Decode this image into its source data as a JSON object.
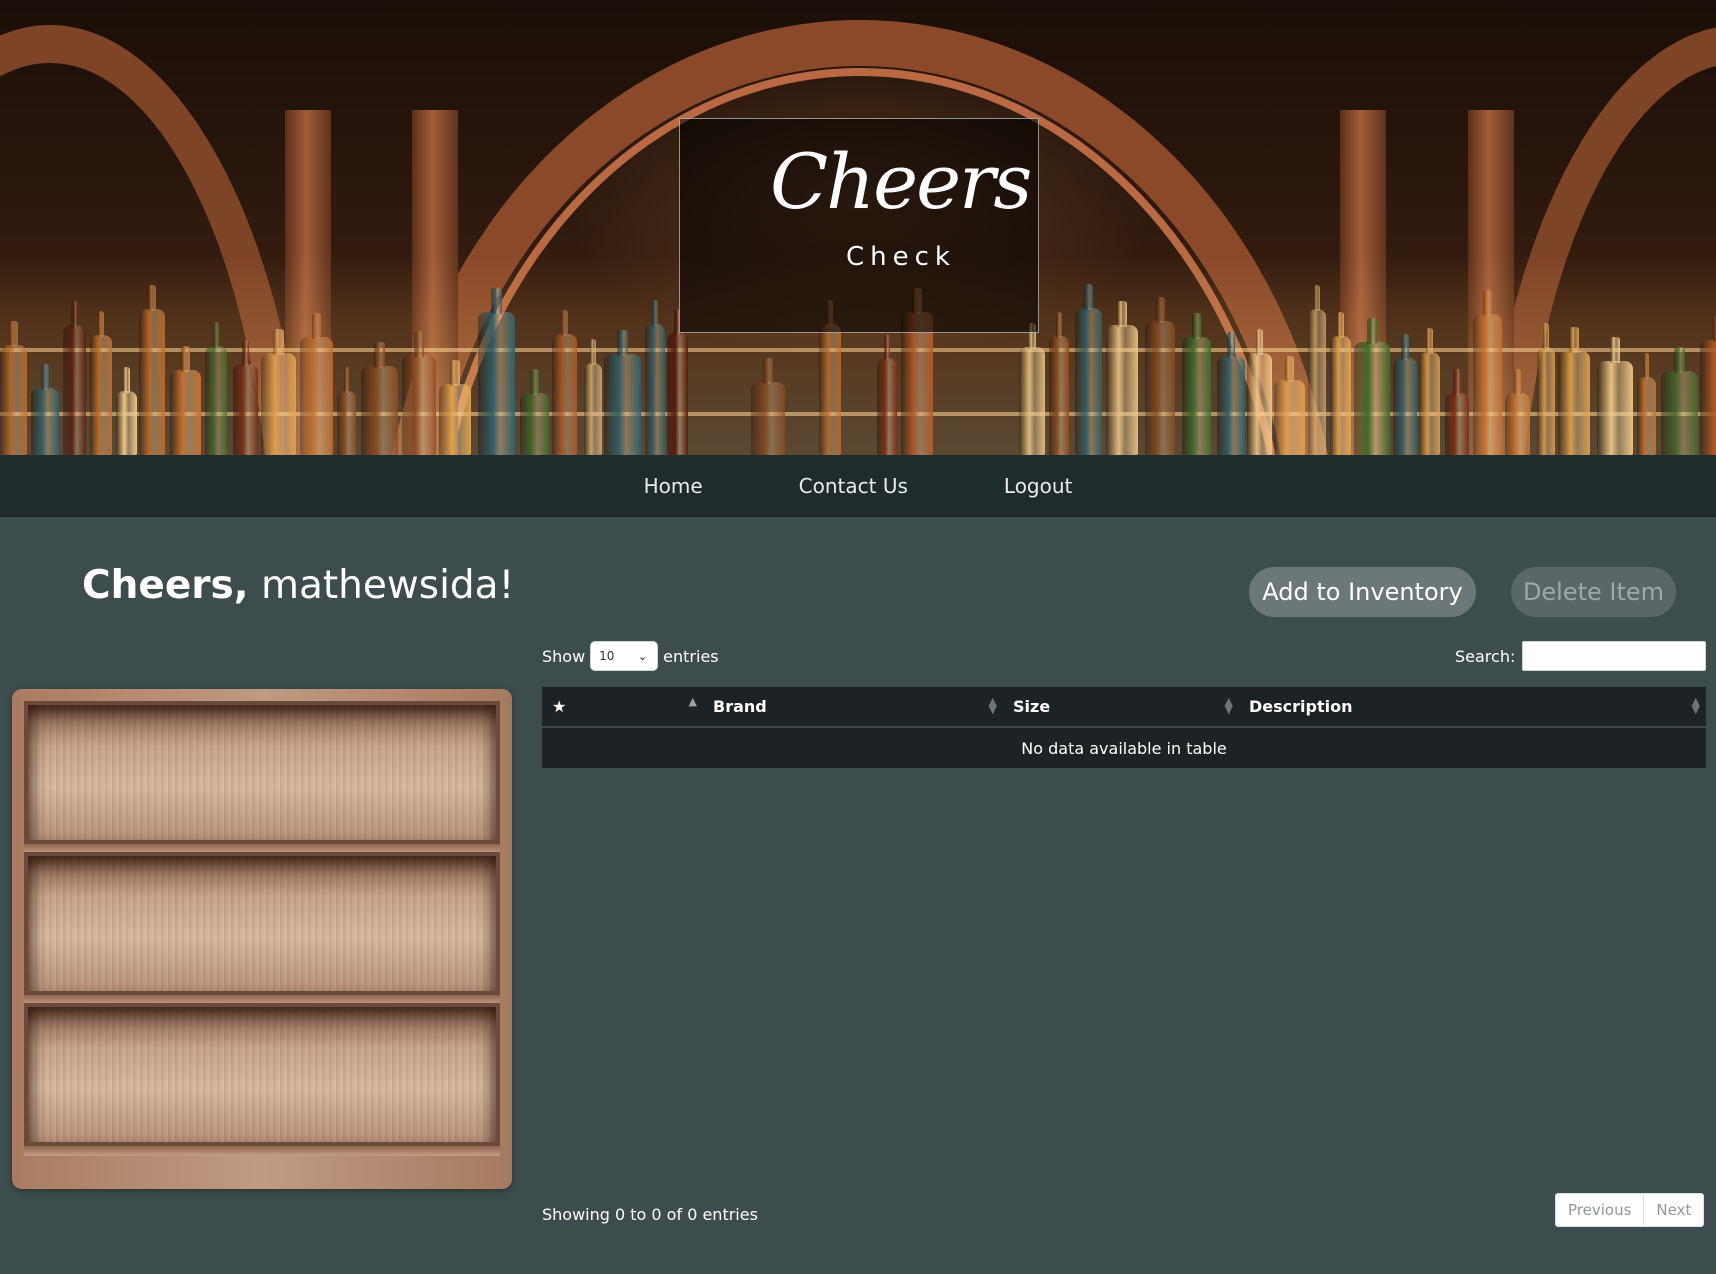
{
  "brand": {
    "logo_script": "Cheers",
    "logo_sub": "Check"
  },
  "nav": {
    "items": [
      {
        "label": "Home"
      },
      {
        "label": "Contact Us"
      },
      {
        "label": "Logout"
      }
    ]
  },
  "greeting": {
    "prefix": "Cheers,",
    "username": "mathewsida!"
  },
  "actions": {
    "add_label": "Add to Inventory",
    "delete_label": "Delete Item"
  },
  "table_controls": {
    "show_label": "Show",
    "entries_value": "10",
    "entries_label": "entries",
    "search_label": "Search:",
    "search_value": ""
  },
  "table": {
    "columns": [
      "★",
      "Brand",
      "Size",
      "Description"
    ],
    "empty_message": "No data available in table",
    "rows": []
  },
  "footer": {
    "info": "Showing 0 to 0 of 0 entries",
    "previous_label": "Previous",
    "next_label": "Next"
  },
  "colors": {
    "page_bg": "#3d4d4e",
    "nav_bg": "#1f2b2c",
    "table_bg": "#1d2324",
    "button_add": "#6b7778",
    "button_delete": "#596768"
  }
}
